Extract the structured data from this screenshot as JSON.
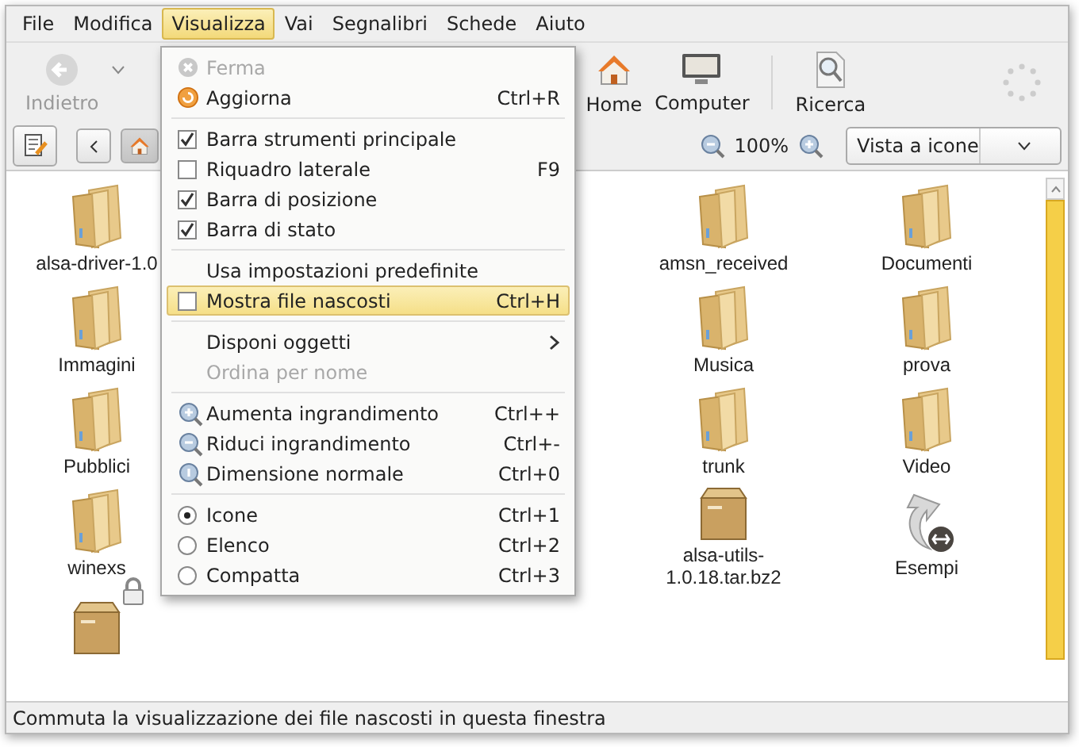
{
  "menubar": [
    {
      "label": "File",
      "selected": false
    },
    {
      "label": "Modifica",
      "selected": false
    },
    {
      "label": "Visualizza",
      "selected": true
    },
    {
      "label": "Vai",
      "selected": false
    },
    {
      "label": "Segnalibri",
      "selected": false
    },
    {
      "label": "Schede",
      "selected": false
    },
    {
      "label": "Aiuto",
      "selected": false
    }
  ],
  "toolbar": [
    {
      "kind": "back",
      "label": "Indietro"
    },
    {
      "kind": "home",
      "label": "Home"
    },
    {
      "kind": "computer",
      "label": "Computer"
    },
    {
      "kind": "search",
      "label": "Ricerca"
    }
  ],
  "zoom": {
    "reading": "100%"
  },
  "view_selector": {
    "value": "Vista a icone"
  },
  "menu": [
    {
      "kind": "stop",
      "label": "Ferma",
      "disabled": true,
      "highlighted": false
    },
    {
      "kind": "reload",
      "label": "Aggiorna",
      "shortcut": "Ctrl+R",
      "disabled": false,
      "highlighted": false
    },
    {
      "kind": "separator"
    },
    {
      "kind": "check",
      "label": "Barra strumenti principale",
      "checked": true,
      "disabled": false,
      "highlighted": false
    },
    {
      "kind": "check",
      "label": "Riquadro laterale",
      "shortcut": "F9",
      "checked": false,
      "disabled": false,
      "highlighted": false
    },
    {
      "kind": "check",
      "label": "Barra di posizione",
      "checked": true,
      "disabled": false,
      "highlighted": false
    },
    {
      "kind": "check",
      "label": "Barra di stato",
      "checked": true,
      "disabled": false,
      "highlighted": false
    },
    {
      "kind": "separator"
    },
    {
      "kind": "plain",
      "label": "Usa impostazioni predefinite",
      "disabled": false,
      "highlighted": false
    },
    {
      "kind": "check",
      "label": "Mostra file nascosti",
      "shortcut": "Ctrl+H",
      "checked": false,
      "disabled": false,
      "highlighted": true
    },
    {
      "kind": "separator"
    },
    {
      "kind": "submenu",
      "label": "Disponi oggetti",
      "disabled": false,
      "highlighted": false
    },
    {
      "kind": "plain",
      "label": "Ordina per nome",
      "disabled": true,
      "highlighted": false
    },
    {
      "kind": "separator"
    },
    {
      "kind": "zoomin",
      "label": "Aumenta ingrandimento",
      "shortcut": "Ctrl++",
      "disabled": false,
      "highlighted": false
    },
    {
      "kind": "zoomout",
      "label": "Riduci ingrandimento",
      "shortcut": "Ctrl+-",
      "disabled": false,
      "highlighted": false
    },
    {
      "kind": "zoomreset",
      "label": "Dimensione normale",
      "shortcut": "Ctrl+0",
      "disabled": false,
      "highlighted": false
    },
    {
      "kind": "separator"
    },
    {
      "kind": "radio",
      "label": "Icone",
      "shortcut": "Ctrl+1",
      "selected": true,
      "disabled": false,
      "highlighted": false
    },
    {
      "kind": "radio",
      "label": "Elenco",
      "shortcut": "Ctrl+2",
      "selected": false,
      "disabled": false,
      "highlighted": false
    },
    {
      "kind": "radio",
      "label": "Compatta",
      "shortcut": "Ctrl+3",
      "selected": false,
      "disabled": false,
      "highlighted": false
    }
  ],
  "files": [
    {
      "left": [
        {
          "kind": "folder",
          "name": "alsa-driver-1.0"
        }
      ],
      "right": [
        {
          "kind": "folder",
          "name": "amsn_received"
        },
        {
          "kind": "folder",
          "name": "Documenti"
        }
      ]
    },
    {
      "left": [
        {
          "kind": "folder",
          "name": "Immagini"
        }
      ],
      "right": [
        {
          "kind": "folder",
          "name": "Musica"
        },
        {
          "kind": "folder",
          "name": "prova"
        }
      ]
    },
    {
      "left": [
        {
          "kind": "folder",
          "name": "Pubblici"
        }
      ],
      "right": [
        {
          "kind": "folder",
          "name": "trunk"
        },
        {
          "kind": "folder",
          "name": "Video"
        }
      ]
    },
    {
      "left": [
        {
          "kind": "folder",
          "name": "winexs"
        }
      ],
      "right": [
        {
          "kind": "archive",
          "name": "alsa-utils-1.0.18.tar.bz2"
        },
        {
          "kind": "link",
          "name": "Esempi"
        }
      ]
    },
    {
      "left": [
        {
          "kind": "archive",
          "locked": true
        }
      ]
    }
  ],
  "status_bar": {
    "text": "Commuta la visualizzazione dei file nascosti in questa finestra"
  }
}
